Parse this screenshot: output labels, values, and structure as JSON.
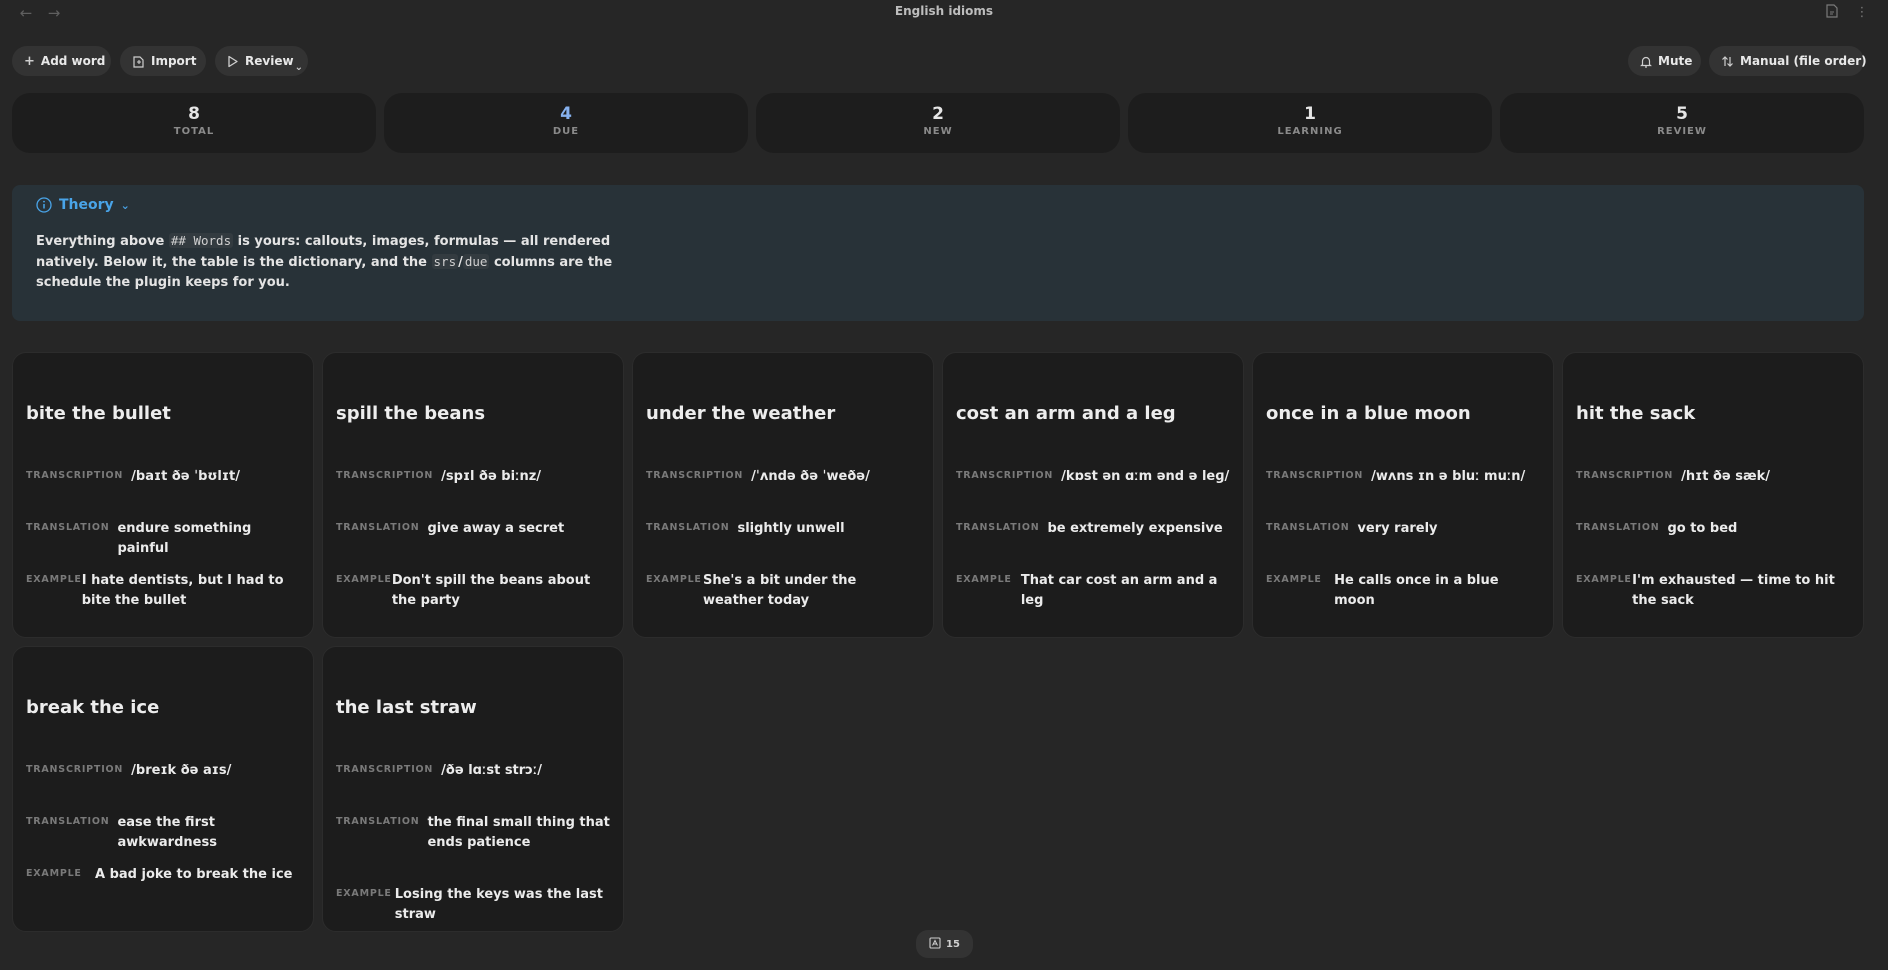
{
  "window": {
    "title": "English idioms"
  },
  "toolbar": {
    "add_word": "Add word",
    "import": "Import",
    "review": "Review",
    "mute": "Mute",
    "sort": "Manual (file order)"
  },
  "stats": [
    {
      "value": "8",
      "label": "TOTAL"
    },
    {
      "value": "4",
      "label": "DUE"
    },
    {
      "value": "2",
      "label": "NEW"
    },
    {
      "value": "1",
      "label": "LEARNING"
    },
    {
      "value": "5",
      "label": "REVIEW"
    }
  ],
  "theory": {
    "title": "Theory",
    "t1": "Everything above ",
    "code1": "## Words",
    "t2": " is yours: callouts, images, formulas — all rendered natively. Below it, the table is the dictionary, and the ",
    "code2": "srs",
    "t3": "/",
    "code3": "due",
    "t4": " columns are the schedule the plugin keeps for you."
  },
  "labels": {
    "transcription": "TRANSCRIPTION",
    "translation": "TRANSLATION",
    "example": "EXAMPLE"
  },
  "cards": [
    {
      "word": "bite the bullet",
      "transcription": "/baɪt ðə ˈbʊlɪt/",
      "translation": "endure something painful",
      "example": "I hate dentists, but I had to bite the bullet"
    },
    {
      "word": "spill the beans",
      "transcription": "/spɪl ðə biːnz/",
      "translation": "give away a secret",
      "example": "Don't spill the beans about the party"
    },
    {
      "word": "under the weather",
      "transcription": "/ˈʌndə ðə ˈweðə/",
      "translation": "slightly unwell",
      "example": "She's a bit under the weather today"
    },
    {
      "word": "cost an arm and a leg",
      "transcription": "/kɒst ən ɑːm ənd ə leɡ/",
      "translation": "be extremely expensive",
      "example": "That car cost an arm and a leg"
    },
    {
      "word": "once in a blue moon",
      "transcription": "/wʌns ɪn ə bluː muːn/",
      "translation": "very rarely",
      "example": "He calls once in a blue moon"
    },
    {
      "word": "hit the sack",
      "transcription": "/hɪt ðə sæk/",
      "translation": "go to bed",
      "example": "I'm exhausted — time to hit the sack"
    },
    {
      "word": "break the ice",
      "transcription": "/breɪk ðə aɪs/",
      "translation": "ease the first awkwardness",
      "example": "A bad joke to break the ice"
    },
    {
      "word": "the last straw",
      "transcription": "/ðə lɑːst strɔː/",
      "translation": "the final small thing that ends patience",
      "example": "Losing the keys was the last straw"
    }
  ],
  "status": {
    "count": "15"
  }
}
